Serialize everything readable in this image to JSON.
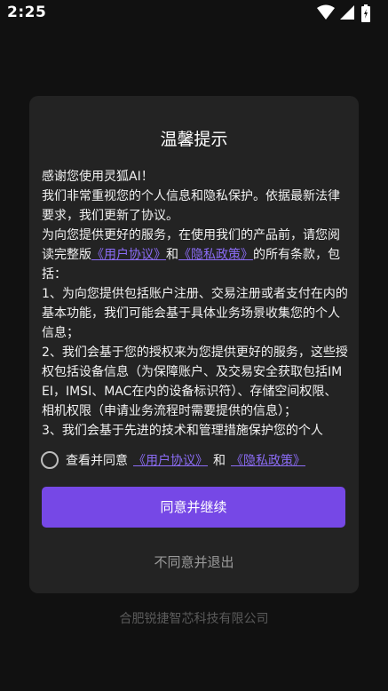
{
  "status_bar": {
    "time": "2:25",
    "icons": [
      "wifi-icon",
      "cellular-signal-icon",
      "battery-charging-icon"
    ]
  },
  "dialog": {
    "title": "温馨提示",
    "greeting": "感谢您使用灵狐AI！",
    "intro": "我们非常重视您的个人信息和隐私保护。依据最新法律要求，我们更新了协议。",
    "read_prefix": " 为向您提供更好的服务，在使用我们的产品前，请您阅读完整版",
    "user_agreement_link": "《用户协议》",
    "and_text": "和",
    "privacy_link": "《隐私政策》",
    "read_suffix": "的所有条款，包括：",
    "item_1": " 1、为向您提供包括账户注册、交易注册或者支付在内的基本功能，我们可能会基于具体业务场景收集您的个人信息；",
    "item_2": " 2、我们会基于您的授权来为您提供更好的服务，这些授权包括设备信息（为保障账户、及交易安全获取包括IMEI，IMSI、MAC在内的设备标识符）、存储空间权限、相机权限（申请业务流程时需要提供的信息）；",
    "item_3_partial": " 3、我们会基于先进的技术和管理措施保护您的个人",
    "agree_prefix": "查看并同意",
    "agree_user_agreement": "《用户协议》",
    "agree_and": "和",
    "agree_privacy": "《隐私政策》",
    "continue_label": "同意并继续",
    "exit_label": "不同意并退出"
  },
  "footer": {
    "company": "合肥锐捷智芯科技有限公司"
  },
  "colors": {
    "background": "#111111",
    "dialog": "#232323",
    "accent": "#7648e6",
    "link": "#8b6cf5"
  }
}
